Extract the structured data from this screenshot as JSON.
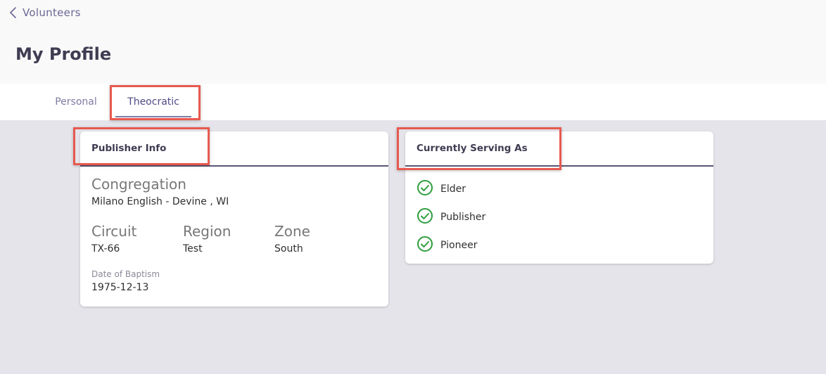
{
  "header": {
    "back_label": "Volunteers",
    "title": "My Profile"
  },
  "tabs": [
    {
      "label": "Personal",
      "active": false
    },
    {
      "label": "Theocratic",
      "active": true
    }
  ],
  "publisher_info": {
    "title": "Publisher Info",
    "congregation_label": "Congregation",
    "congregation_value": "Milano English - Devine , WI",
    "circuit_label": "Circuit",
    "circuit_value": "TX-66",
    "region_label": "Region",
    "region_value": "Test",
    "zone_label": "Zone",
    "zone_value": "South",
    "baptism_label": "Date of Baptism",
    "baptism_value": "1975-12-13"
  },
  "serving": {
    "title": "Currently Serving As",
    "items": [
      {
        "label": "Elder",
        "icon": "check-circle-icon"
      },
      {
        "label": "Publisher",
        "icon": "check-circle-icon"
      },
      {
        "label": "Pioneer",
        "icon": "check-circle-icon"
      }
    ]
  },
  "colors": {
    "accent": "#7e7ba3",
    "highlight": "#e8594e",
    "check": "#2e9e3e",
    "background": "#e5e4ea"
  }
}
